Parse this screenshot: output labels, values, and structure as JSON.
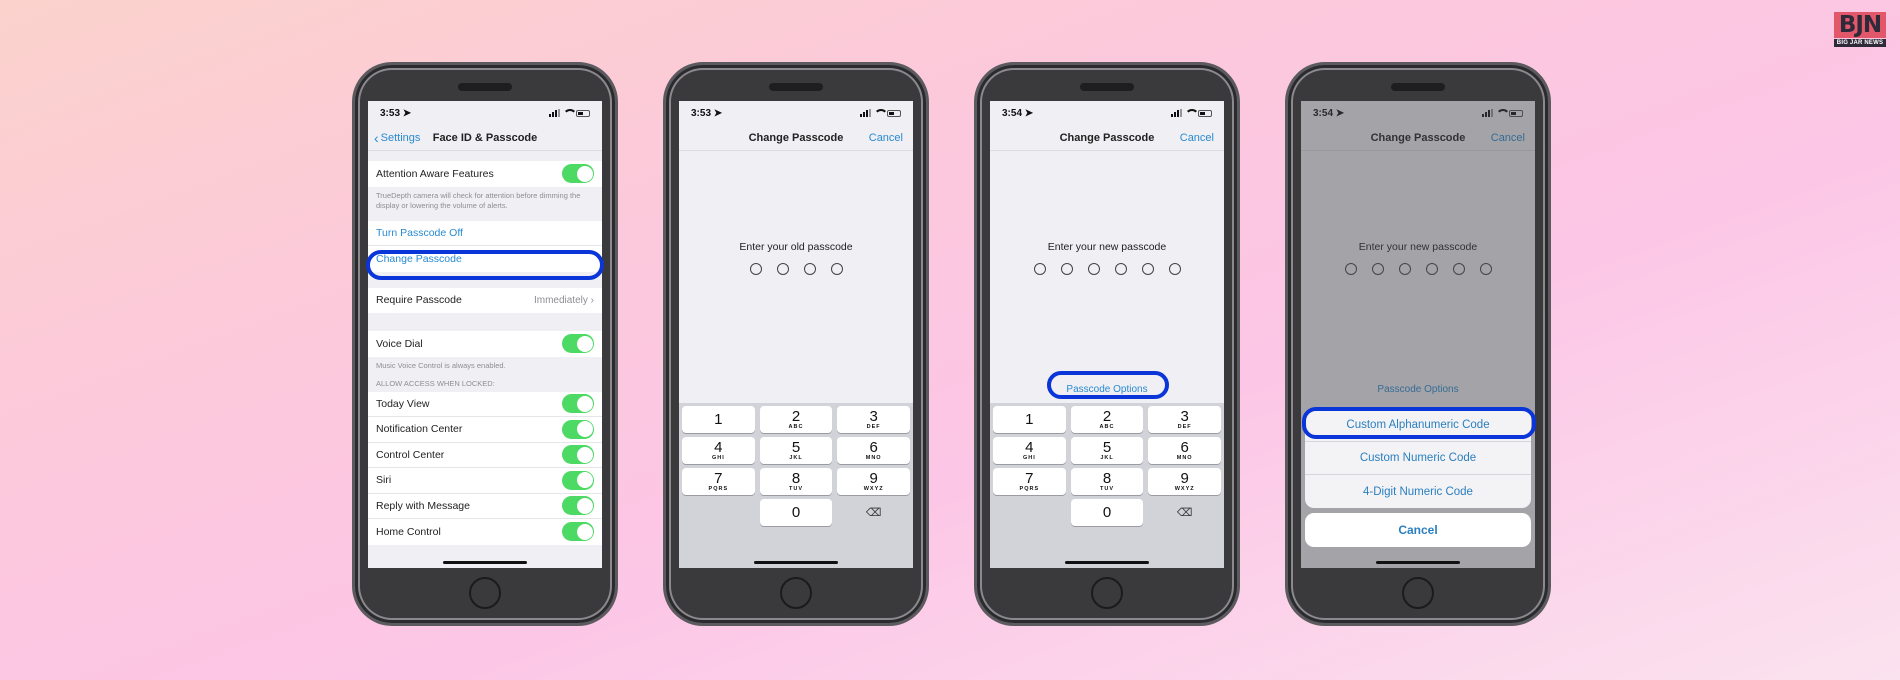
{
  "logo": {
    "title": "BJN",
    "subtitle": "BIG JAR NEWS"
  },
  "colors": {
    "highlight": "#0a35d8",
    "ios_blue": "#2a8ad1",
    "toggle_on": "#4cd964"
  },
  "phones": [
    {
      "status_time": "3:53",
      "nav": {
        "back_label": "Settings",
        "title": "Face ID & Passcode"
      },
      "attention": {
        "label": "Attention Aware Features",
        "on": true,
        "footer": "TrueDepth camera will check for attention before dimming the display or lowering the volume of alerts."
      },
      "links": [
        "Turn Passcode Off",
        "Change Passcode"
      ],
      "require": {
        "label": "Require Passcode",
        "value": "Immediately"
      },
      "voice_dial": {
        "label": "Voice Dial",
        "on": true,
        "footer": "Music Voice Control is always enabled."
      },
      "locked_header": "ALLOW ACCESS WHEN LOCKED:",
      "locked_items": [
        {
          "label": "Today View",
          "on": true
        },
        {
          "label": "Notification Center",
          "on": true
        },
        {
          "label": "Control Center",
          "on": true
        },
        {
          "label": "Siri",
          "on": true
        },
        {
          "label": "Reply with Message",
          "on": true
        },
        {
          "label": "Home Control",
          "on": true
        }
      ],
      "highlighted": "Change Passcode"
    },
    {
      "status_time": "3:53",
      "nav": {
        "title": "Change Passcode",
        "right_label": "Cancel"
      },
      "prompt": "Enter your old passcode",
      "digit_count": 4
    },
    {
      "status_time": "3:54",
      "nav": {
        "title": "Change Passcode",
        "right_label": "Cancel"
      },
      "prompt": "Enter your new passcode",
      "digit_count": 6,
      "options_label": "Passcode Options",
      "highlighted": "Passcode Options"
    },
    {
      "status_time": "3:54",
      "nav": {
        "title": "Change Passcode",
        "right_label": "Cancel"
      },
      "prompt": "Enter your new passcode",
      "digit_count": 6,
      "options_label": "Passcode Options",
      "sheet_items": [
        "Custom Alphanumeric Code",
        "Custom Numeric Code",
        "4-Digit Numeric Code"
      ],
      "sheet_cancel": "Cancel",
      "highlighted": "Custom Alphanumeric Code"
    }
  ],
  "keypad": {
    "rows": [
      [
        {
          "n": "1",
          "l": ""
        },
        {
          "n": "2",
          "l": "ABC"
        },
        {
          "n": "3",
          "l": "DEF"
        }
      ],
      [
        {
          "n": "4",
          "l": "GHI"
        },
        {
          "n": "5",
          "l": "JKL"
        },
        {
          "n": "6",
          "l": "MNO"
        }
      ],
      [
        {
          "n": "7",
          "l": "PQRS"
        },
        {
          "n": "8",
          "l": "TUV"
        },
        {
          "n": "9",
          "l": "WXYZ"
        }
      ]
    ],
    "zero": "0",
    "delete_icon": "⌫"
  }
}
